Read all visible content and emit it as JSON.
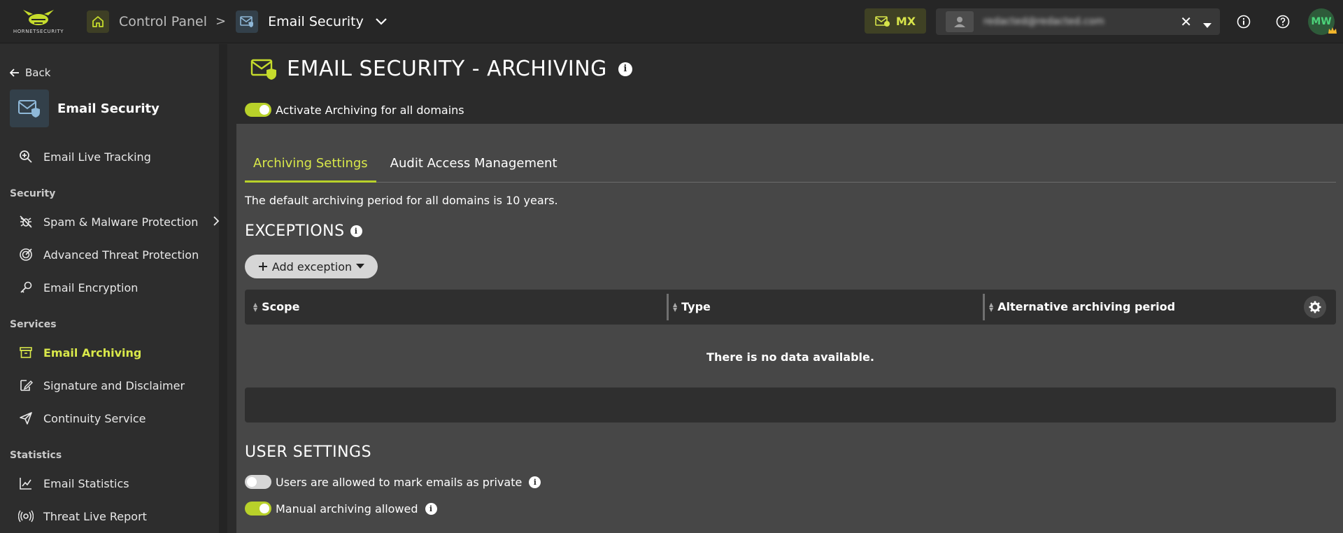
{
  "topbar": {
    "logo_text": "HORNETSECURITY",
    "breadcrumb_root": "Control Panel",
    "breadcrumb_sep": ">",
    "breadcrumb_current": "Email Security",
    "mx_label": "MX",
    "user_value": "redacted@redacted.com",
    "clear_symbol": "✕",
    "avatar_initials": "MW"
  },
  "sidebar": {
    "back_label": "Back",
    "app_title": "Email Security",
    "items": [
      {
        "label": "Email Live Tracking",
        "icon": "search-zoom-icon"
      },
      {
        "label": "Spam & Malware Protection",
        "icon": "bug-off-icon"
      },
      {
        "label": "Advanced Threat Protection",
        "icon": "target-icon"
      },
      {
        "label": "Email Encryption",
        "icon": "key-icon"
      },
      {
        "label": "Email Archiving",
        "icon": "archive-box-icon"
      },
      {
        "label": "Signature and Disclaimer",
        "icon": "signature-icon"
      },
      {
        "label": "Continuity Service",
        "icon": "paper-plane-icon"
      },
      {
        "label": "Email Statistics",
        "icon": "chart-line-icon"
      },
      {
        "label": "Threat Live Report",
        "icon": "broadcast-icon"
      }
    ],
    "sections": [
      "Security",
      "Services",
      "Statistics"
    ]
  },
  "main": {
    "title": "EMAIL SECURITY - ARCHIVING",
    "activate_label": "Activate Archiving for all domains",
    "activate_on": true,
    "tabs": [
      {
        "label": "Archiving Settings",
        "active": true
      },
      {
        "label": "Audit Access Management",
        "active": false
      }
    ],
    "default_text": "The default archiving period for all domains is 10 years.",
    "exceptions_title": "EXCEPTIONS",
    "add_exception_label": "Add exception",
    "table": {
      "columns": [
        "Scope",
        "Type",
        "Alternative archiving period"
      ],
      "empty_text": "There is no data available."
    },
    "user_settings_title": "USER SETTINGS",
    "user_settings": [
      {
        "label": "Users are allowed to mark emails as private",
        "on": false
      },
      {
        "label": "Manual archiving allowed",
        "on": true
      }
    ]
  },
  "colors": {
    "accent": "#b8d12a",
    "accent_text": "#d9e84a",
    "background": "#2b2b2b",
    "panel": "#474747"
  }
}
